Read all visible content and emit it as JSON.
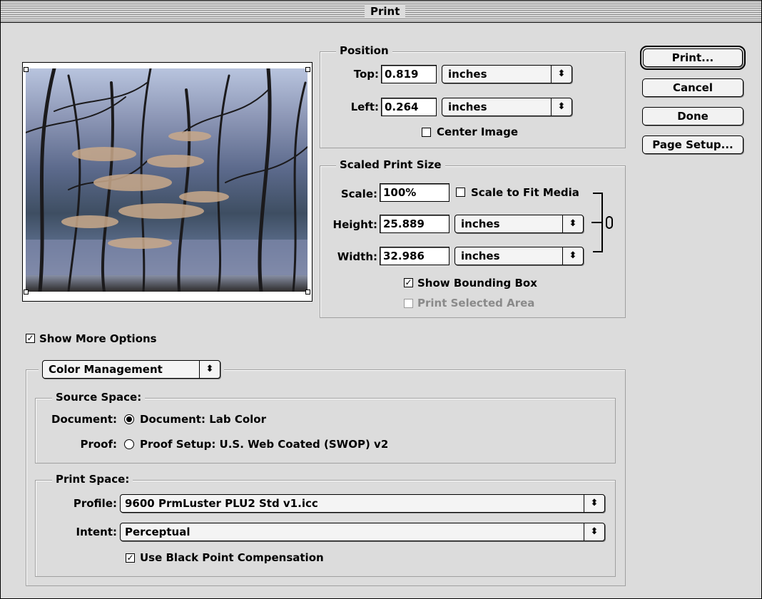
{
  "window": {
    "title": "Print"
  },
  "position": {
    "legend": "Position",
    "top_label": "Top:",
    "top_value": "0.819",
    "top_unit": "inches",
    "left_label": "Left:",
    "left_value": "0.264",
    "left_unit": "inches",
    "center_image_label": "Center Image",
    "center_image_checked": false
  },
  "scaled": {
    "legend": "Scaled Print Size",
    "scale_label": "Scale:",
    "scale_value": "100%",
    "scale_to_fit_label": "Scale to Fit Media",
    "scale_to_fit_checked": false,
    "height_label": "Height:",
    "height_value": "25.889",
    "height_unit": "inches",
    "width_label": "Width:",
    "width_value": "32.986",
    "width_unit": "inches",
    "show_bbox_label": "Show Bounding Box",
    "show_bbox_checked": true,
    "print_selected_label": "Print Selected Area",
    "print_selected_checked": false
  },
  "buttons": {
    "print": "Print...",
    "cancel": "Cancel",
    "done": "Done",
    "page_setup": "Page Setup..."
  },
  "more_options": {
    "label": "Show More Options",
    "checked": true
  },
  "color_mgmt": {
    "popup": "Color Management",
    "source": {
      "legend": "Source Space:",
      "document_label": "Document:",
      "document_option": "Document: Lab Color",
      "document_selected": true,
      "proof_label": "Proof:",
      "proof_option": "Proof Setup: U.S. Web Coated (SWOP) v2",
      "proof_selected": false
    },
    "print_space": {
      "legend": "Print Space:",
      "profile_label": "Profile:",
      "profile_value": "9600 PrmLuster PLU2 Std v1.icc",
      "intent_label": "Intent:",
      "intent_value": "Perceptual",
      "bpc_label": "Use Black Point Compensation",
      "bpc_checked": true
    }
  },
  "glyphs": {
    "updown": "⬍",
    "check": "✓"
  },
  "colors": {
    "dialog_bg": "#dcdcdc",
    "group_line": "#a0a0a0"
  }
}
